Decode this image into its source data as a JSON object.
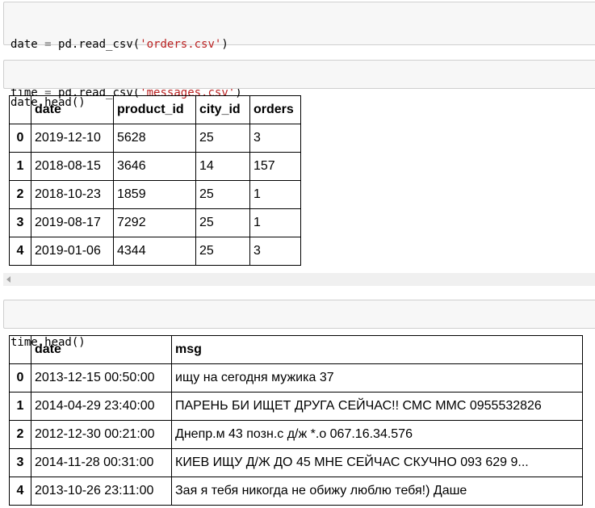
{
  "cell1": {
    "lines": [
      {
        "var": "date",
        "op": "=",
        "call": "pd.read_csv(",
        "arg": "'orders.csv'",
        "close": ")"
      },
      {
        "var": "time",
        "op": "=",
        "call": "pd.read_csv(",
        "arg": "'messages.csv'",
        "close": ")"
      }
    ]
  },
  "cell2": {
    "code": "date.head()"
  },
  "orders_table": {
    "columns": [
      "",
      "date",
      "product_id",
      "city_id",
      "orders"
    ],
    "rows": [
      {
        "idx": "0",
        "date": "2019-12-10",
        "product_id": "5628",
        "city_id": "25",
        "orders": "3"
      },
      {
        "idx": "1",
        "date": "2018-08-15",
        "product_id": "3646",
        "city_id": "14",
        "orders": "157"
      },
      {
        "idx": "2",
        "date": "2018-10-23",
        "product_id": "1859",
        "city_id": "25",
        "orders": "1"
      },
      {
        "idx": "3",
        "date": "2019-08-17",
        "product_id": "7292",
        "city_id": "25",
        "orders": "1"
      },
      {
        "idx": "4",
        "date": "2019-01-06",
        "product_id": "4344",
        "city_id": "25",
        "orders": "3"
      }
    ]
  },
  "cell3": {
    "code": "time.head()"
  },
  "messages_table": {
    "columns": [
      "",
      "date",
      "msg"
    ],
    "rows": [
      {
        "idx": "0",
        "date": "2013-12-15 00:50:00",
        "msg": "ищу на сегодня мужика 37"
      },
      {
        "idx": "1",
        "date": "2014-04-29 23:40:00",
        "msg": "ПАРЕНЬ БИ ИЩЕТ ДРУГА СЕЙЧАС!! СМС ММС 0955532826"
      },
      {
        "idx": "2",
        "date": "2012-12-30 00:21:00",
        "msg": "Днепр.м 43 позн.с д/ж *.о 067.16.34.576"
      },
      {
        "idx": "3",
        "date": "2014-11-28 00:31:00",
        "msg": "КИЕВ ИЩУ Д/Ж ДО 45 МНЕ СЕЙЧАС СКУЧНО 093 629 9..."
      },
      {
        "idx": "4",
        "date": "2013-10-26 23:11:00",
        "msg": "Зая я тебя никогда не обижу люблю тебя!) Даше"
      }
    ]
  },
  "colors": {
    "string": "#ba2121",
    "cell_bg": "#f7f7f7",
    "cell_border": "#cfcfcf"
  },
  "icons": {
    "scroll_left": "scroll-left-arrow-icon"
  }
}
